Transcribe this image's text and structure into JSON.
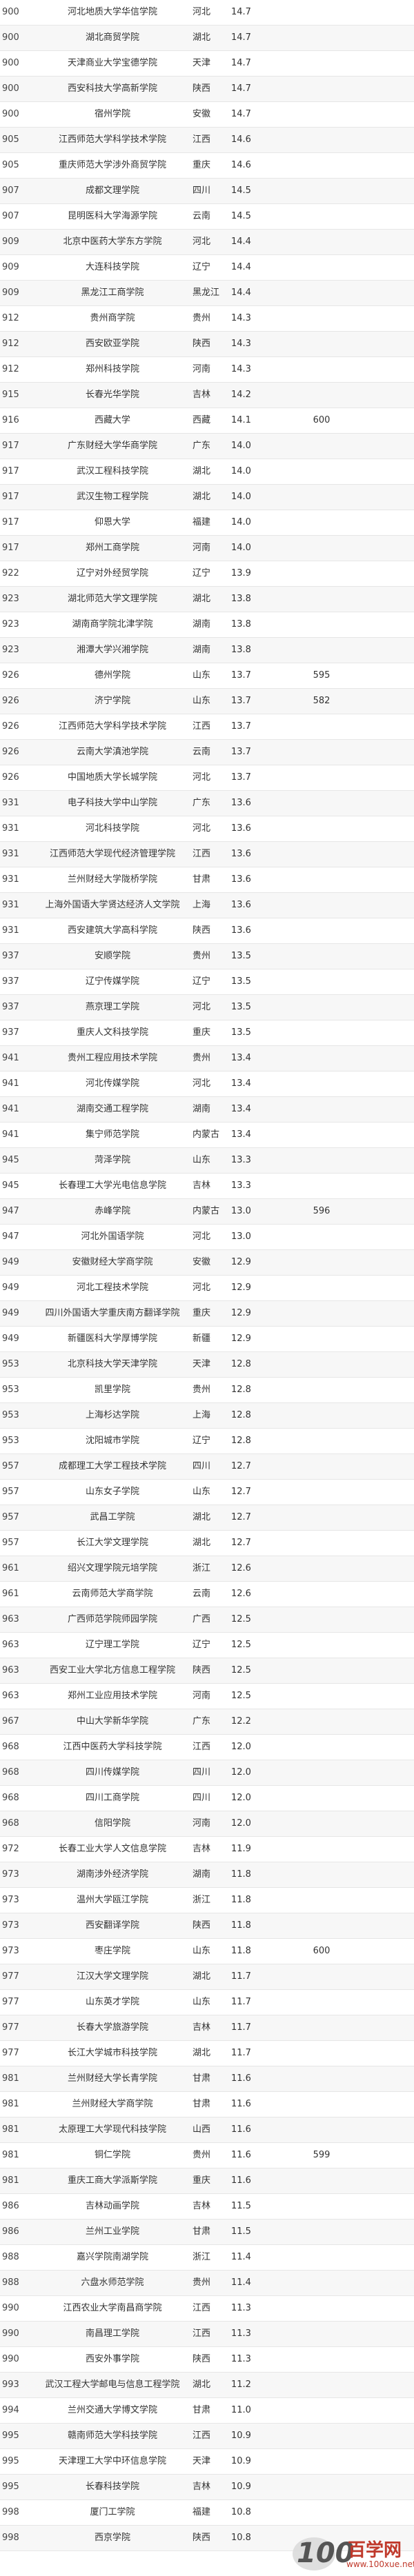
{
  "rows": [
    {
      "rank": "900",
      "name": "河北地质大学华信学院",
      "prov": "河北",
      "score": "14.7",
      "extra": ""
    },
    {
      "rank": "900",
      "name": "湖北商贸学院",
      "prov": "湖北",
      "score": "14.7",
      "extra": ""
    },
    {
      "rank": "900",
      "name": "天津商业大学宝德学院",
      "prov": "天津",
      "score": "14.7",
      "extra": ""
    },
    {
      "rank": "900",
      "name": "西安科技大学高新学院",
      "prov": "陕西",
      "score": "14.7",
      "extra": ""
    },
    {
      "rank": "900",
      "name": "宿州学院",
      "prov": "安徽",
      "score": "14.7",
      "extra": ""
    },
    {
      "rank": "905",
      "name": "江西师范大学科学技术学院",
      "prov": "江西",
      "score": "14.6",
      "extra": ""
    },
    {
      "rank": "905",
      "name": "重庆师范大学涉外商贸学院",
      "prov": "重庆",
      "score": "14.6",
      "extra": ""
    },
    {
      "rank": "907",
      "name": "成都文理学院",
      "prov": "四川",
      "score": "14.5",
      "extra": ""
    },
    {
      "rank": "907",
      "name": "昆明医科大学海源学院",
      "prov": "云南",
      "score": "14.5",
      "extra": ""
    },
    {
      "rank": "909",
      "name": "北京中医药大学东方学院",
      "prov": "河北",
      "score": "14.4",
      "extra": ""
    },
    {
      "rank": "909",
      "name": "大连科技学院",
      "prov": "辽宁",
      "score": "14.4",
      "extra": ""
    },
    {
      "rank": "909",
      "name": "黑龙江工商学院",
      "prov": "黑龙江",
      "score": "14.4",
      "extra": ""
    },
    {
      "rank": "912",
      "name": "贵州商学院",
      "prov": "贵州",
      "score": "14.3",
      "extra": ""
    },
    {
      "rank": "912",
      "name": "西安欧亚学院",
      "prov": "陕西",
      "score": "14.3",
      "extra": ""
    },
    {
      "rank": "912",
      "name": "郑州科技学院",
      "prov": "河南",
      "score": "14.3",
      "extra": ""
    },
    {
      "rank": "915",
      "name": "长春光华学院",
      "prov": "吉林",
      "score": "14.2",
      "extra": ""
    },
    {
      "rank": "916",
      "name": "西藏大学",
      "prov": "西藏",
      "score": "14.1",
      "extra": "600"
    },
    {
      "rank": "917",
      "name": "广东财经大学华商学院",
      "prov": "广东",
      "score": "14.0",
      "extra": ""
    },
    {
      "rank": "917",
      "name": "武汉工程科技学院",
      "prov": "湖北",
      "score": "14.0",
      "extra": ""
    },
    {
      "rank": "917",
      "name": "武汉生物工程学院",
      "prov": "湖北",
      "score": "14.0",
      "extra": ""
    },
    {
      "rank": "917",
      "name": "仰恩大学",
      "prov": "福建",
      "score": "14.0",
      "extra": ""
    },
    {
      "rank": "917",
      "name": "郑州工商学院",
      "prov": "河南",
      "score": "14.0",
      "extra": ""
    },
    {
      "rank": "922",
      "name": "辽宁对外经贸学院",
      "prov": "辽宁",
      "score": "13.9",
      "extra": ""
    },
    {
      "rank": "923",
      "name": "湖北师范大学文理学院",
      "prov": "湖北",
      "score": "13.8",
      "extra": ""
    },
    {
      "rank": "923",
      "name": "湖南商学院北津学院",
      "prov": "湖南",
      "score": "13.8",
      "extra": ""
    },
    {
      "rank": "923",
      "name": "湘潭大学兴湘学院",
      "prov": "湖南",
      "score": "13.8",
      "extra": ""
    },
    {
      "rank": "926",
      "name": "德州学院",
      "prov": "山东",
      "score": "13.7",
      "extra": "595"
    },
    {
      "rank": "926",
      "name": "济宁学院",
      "prov": "山东",
      "score": "13.7",
      "extra": "582"
    },
    {
      "rank": "926",
      "name": "江西师范大学科学技术学院",
      "prov": "江西",
      "score": "13.7",
      "extra": ""
    },
    {
      "rank": "926",
      "name": "云南大学滇池学院",
      "prov": "云南",
      "score": "13.7",
      "extra": ""
    },
    {
      "rank": "926",
      "name": "中国地质大学长城学院",
      "prov": "河北",
      "score": "13.7",
      "extra": ""
    },
    {
      "rank": "931",
      "name": "电子科技大学中山学院",
      "prov": "广东",
      "score": "13.6",
      "extra": ""
    },
    {
      "rank": "931",
      "name": "河北科技学院",
      "prov": "河北",
      "score": "13.6",
      "extra": ""
    },
    {
      "rank": "931",
      "name": "江西师范大学现代经济管理学院",
      "prov": "江西",
      "score": "13.6",
      "extra": ""
    },
    {
      "rank": "931",
      "name": "兰州财经大学陇桥学院",
      "prov": "甘肃",
      "score": "13.6",
      "extra": ""
    },
    {
      "rank": "931",
      "name": "上海外国语大学贤达经济人文学院",
      "prov": "上海",
      "score": "13.6",
      "extra": ""
    },
    {
      "rank": "931",
      "name": "西安建筑大学高科学院",
      "prov": "陕西",
      "score": "13.6",
      "extra": ""
    },
    {
      "rank": "937",
      "name": "安顺学院",
      "prov": "贵州",
      "score": "13.5",
      "extra": ""
    },
    {
      "rank": "937",
      "name": "辽宁传媒学院",
      "prov": "辽宁",
      "score": "13.5",
      "extra": ""
    },
    {
      "rank": "937",
      "name": "燕京理工学院",
      "prov": "河北",
      "score": "13.5",
      "extra": ""
    },
    {
      "rank": "937",
      "name": "重庆人文科技学院",
      "prov": "重庆",
      "score": "13.5",
      "extra": ""
    },
    {
      "rank": "941",
      "name": "贵州工程应用技术学院",
      "prov": "贵州",
      "score": "13.4",
      "extra": ""
    },
    {
      "rank": "941",
      "name": "河北传媒学院",
      "prov": "河北",
      "score": "13.4",
      "extra": ""
    },
    {
      "rank": "941",
      "name": "湖南交通工程学院",
      "prov": "湖南",
      "score": "13.4",
      "extra": ""
    },
    {
      "rank": "941",
      "name": "集宁师范学院",
      "prov": "内蒙古",
      "score": "13.4",
      "extra": ""
    },
    {
      "rank": "945",
      "name": "菏泽学院",
      "prov": "山东",
      "score": "13.3",
      "extra": ""
    },
    {
      "rank": "945",
      "name": "长春理工大学光电信息学院",
      "prov": "吉林",
      "score": "13.3",
      "extra": ""
    },
    {
      "rank": "947",
      "name": "赤峰学院",
      "prov": "内蒙古",
      "score": "13.0",
      "extra": "596"
    },
    {
      "rank": "947",
      "name": "河北外国语学院",
      "prov": "河北",
      "score": "13.0",
      "extra": ""
    },
    {
      "rank": "949",
      "name": "安徽财经大学商学院",
      "prov": "安徽",
      "score": "12.9",
      "extra": ""
    },
    {
      "rank": "949",
      "name": "河北工程技术学院",
      "prov": "河北",
      "score": "12.9",
      "extra": ""
    },
    {
      "rank": "949",
      "name": "四川外国语大学重庆南方翻译学院",
      "prov": "重庆",
      "score": "12.9",
      "extra": ""
    },
    {
      "rank": "949",
      "name": "新疆医科大学厚博学院",
      "prov": "新疆",
      "score": "12.9",
      "extra": ""
    },
    {
      "rank": "953",
      "name": "北京科技大学天津学院",
      "prov": "天津",
      "score": "12.8",
      "extra": ""
    },
    {
      "rank": "953",
      "name": "凯里学院",
      "prov": "贵州",
      "score": "12.8",
      "extra": ""
    },
    {
      "rank": "953",
      "name": "上海杉达学院",
      "prov": "上海",
      "score": "12.8",
      "extra": ""
    },
    {
      "rank": "953",
      "name": "沈阳城市学院",
      "prov": "辽宁",
      "score": "12.8",
      "extra": ""
    },
    {
      "rank": "957",
      "name": "成都理工大学工程技术学院",
      "prov": "四川",
      "score": "12.7",
      "extra": ""
    },
    {
      "rank": "957",
      "name": "山东女子学院",
      "prov": "山东",
      "score": "12.7",
      "extra": ""
    },
    {
      "rank": "957",
      "name": "武昌工学院",
      "prov": "湖北",
      "score": "12.7",
      "extra": ""
    },
    {
      "rank": "957",
      "name": "长江大学文理学院",
      "prov": "湖北",
      "score": "12.7",
      "extra": ""
    },
    {
      "rank": "961",
      "name": "绍兴文理学院元培学院",
      "prov": "浙江",
      "score": "12.6",
      "extra": ""
    },
    {
      "rank": "961",
      "name": "云南师范大学商学院",
      "prov": "云南",
      "score": "12.6",
      "extra": ""
    },
    {
      "rank": "963",
      "name": "广西师范学院师园学院",
      "prov": "广西",
      "score": "12.5",
      "extra": ""
    },
    {
      "rank": "963",
      "name": "辽宁理工学院",
      "prov": "辽宁",
      "score": "12.5",
      "extra": ""
    },
    {
      "rank": "963",
      "name": "西安工业大学北方信息工程学院",
      "prov": "陕西",
      "score": "12.5",
      "extra": ""
    },
    {
      "rank": "963",
      "name": "郑州工业应用技术学院",
      "prov": "河南",
      "score": "12.5",
      "extra": ""
    },
    {
      "rank": "967",
      "name": "中山大学新华学院",
      "prov": "广东",
      "score": "12.2",
      "extra": ""
    },
    {
      "rank": "968",
      "name": "江西中医药大学科技学院",
      "prov": "江西",
      "score": "12.0",
      "extra": ""
    },
    {
      "rank": "968",
      "name": "四川传媒学院",
      "prov": "四川",
      "score": "12.0",
      "extra": ""
    },
    {
      "rank": "968",
      "name": "四川工商学院",
      "prov": "四川",
      "score": "12.0",
      "extra": ""
    },
    {
      "rank": "968",
      "name": "信阳学院",
      "prov": "河南",
      "score": "12.0",
      "extra": ""
    },
    {
      "rank": "972",
      "name": "长春工业大学人文信息学院",
      "prov": "吉林",
      "score": "11.9",
      "extra": ""
    },
    {
      "rank": "973",
      "name": "湖南涉外经济学院",
      "prov": "湖南",
      "score": "11.8",
      "extra": ""
    },
    {
      "rank": "973",
      "name": "温州大学瓯江学院",
      "prov": "浙江",
      "score": "11.8",
      "extra": ""
    },
    {
      "rank": "973",
      "name": "西安翻译学院",
      "prov": "陕西",
      "score": "11.8",
      "extra": ""
    },
    {
      "rank": "973",
      "name": "枣庄学院",
      "prov": "山东",
      "score": "11.8",
      "extra": "600"
    },
    {
      "rank": "977",
      "name": "江汉大学文理学院",
      "prov": "湖北",
      "score": "11.7",
      "extra": ""
    },
    {
      "rank": "977",
      "name": "山东英才学院",
      "prov": "山东",
      "score": "11.7",
      "extra": ""
    },
    {
      "rank": "977",
      "name": "长春大学旅游学院",
      "prov": "吉林",
      "score": "11.7",
      "extra": ""
    },
    {
      "rank": "977",
      "name": "长江大学城市科技学院",
      "prov": "湖北",
      "score": "11.7",
      "extra": ""
    },
    {
      "rank": "981",
      "name": "兰州财经大学长青学院",
      "prov": "甘肃",
      "score": "11.6",
      "extra": ""
    },
    {
      "rank": "981",
      "name": "兰州财经大学商学院",
      "prov": "甘肃",
      "score": "11.6",
      "extra": ""
    },
    {
      "rank": "981",
      "name": "太原理工大学现代科技学院",
      "prov": "山西",
      "score": "11.6",
      "extra": ""
    },
    {
      "rank": "981",
      "name": "铜仁学院",
      "prov": "贵州",
      "score": "11.6",
      "extra": "599"
    },
    {
      "rank": "981",
      "name": "重庆工商大学派斯学院",
      "prov": "重庆",
      "score": "11.6",
      "extra": ""
    },
    {
      "rank": "986",
      "name": "吉林动画学院",
      "prov": "吉林",
      "score": "11.5",
      "extra": ""
    },
    {
      "rank": "986",
      "name": "兰州工业学院",
      "prov": "甘肃",
      "score": "11.5",
      "extra": ""
    },
    {
      "rank": "988",
      "name": "嘉兴学院南湖学院",
      "prov": "浙江",
      "score": "11.4",
      "extra": ""
    },
    {
      "rank": "988",
      "name": "六盘水师范学院",
      "prov": "贵州",
      "score": "11.4",
      "extra": ""
    },
    {
      "rank": "990",
      "name": "江西农业大学南昌商学院",
      "prov": "江西",
      "score": "11.3",
      "extra": ""
    },
    {
      "rank": "990",
      "name": "南昌理工学院",
      "prov": "江西",
      "score": "11.3",
      "extra": ""
    },
    {
      "rank": "990",
      "name": "西安外事学院",
      "prov": "陕西",
      "score": "11.3",
      "extra": ""
    },
    {
      "rank": "993",
      "name": "武汉工程大学邮电与信息工程学院",
      "prov": "湖北",
      "score": "11.2",
      "extra": ""
    },
    {
      "rank": "994",
      "name": "兰州交通大学博文学院",
      "prov": "甘肃",
      "score": "11.0",
      "extra": ""
    },
    {
      "rank": "995",
      "name": "赣南师范大学科技学院",
      "prov": "江西",
      "score": "10.9",
      "extra": ""
    },
    {
      "rank": "995",
      "name": "天津理工大学中环信息学院",
      "prov": "天津",
      "score": "10.9",
      "extra": ""
    },
    {
      "rank": "995",
      "name": "长春科技学院",
      "prov": "吉林",
      "score": "10.9",
      "extra": ""
    },
    {
      "rank": "998",
      "name": "厦门工学院",
      "prov": "福建",
      "score": "10.8",
      "extra": ""
    },
    {
      "rank": "998",
      "name": "西京学院",
      "prov": "陕西",
      "score": "10.8",
      "extra": ""
    }
  ],
  "watermark": {
    "logo_text": "100",
    "site_name": "百学网",
    "url": "www.100xue.net"
  }
}
